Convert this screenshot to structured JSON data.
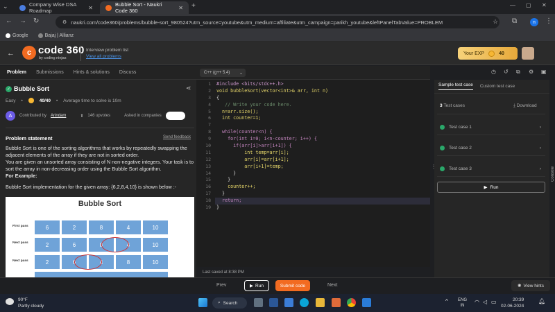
{
  "browser": {
    "tabs": [
      {
        "title": "Company Wise DSA Roadmap",
        "active": false
      },
      {
        "title": "Bubble Sort - Naukri Code 360",
        "active": true
      }
    ],
    "url": "naukri.com/code360/problems/bubble-sort_980524?utm_source=youtube&utm_medium=affiliate&utm_campaign=parikh_youtube&leftPanelTabValue=PROBLEM",
    "bookmarks": [
      "Google",
      "Bajaj | Allianz"
    ],
    "profile_initial": "n"
  },
  "header": {
    "logo_letter": "c",
    "logo_text": "code 360",
    "logo_sub": "by coding ninjas",
    "interview_label": "Interview problem list",
    "interview_link": "View all problems",
    "exp_label": "Your EXP",
    "exp_value": "40"
  },
  "left": {
    "tabs": [
      "Problem",
      "Submissions",
      "Hints & solutions",
      "Discuss"
    ],
    "title": "Bubble Sort",
    "difficulty": "Easy",
    "score": "40/40",
    "avg_time": "Average time to solve is 10m",
    "contributed_prefix": "Contributed by",
    "contributor": "Arindam",
    "upvotes": "146 upvotes",
    "asked_in": "Asked in companies",
    "statement_head": "Problem statement",
    "send_feedback": "Send feedback",
    "desc1": "Bubble Sort is one of the sorting algorithms that works by repeatedly swapping the adjacent elements of the array if they are not in sorted order.",
    "desc2": "You are given an unsorted array consisting of N non-negative integers. Your task is to sort the array in non-decreasing order using the Bubble Sort algorithm.",
    "for_example": "For Example:",
    "example_line": "Bubble Sort implementation for the given array:  {6,2,8,4,10} is shown below :-",
    "image": {
      "title": "Bubble Sort",
      "rows": [
        {
          "label": "First pass",
          "cells": [
            "6",
            "2",
            "8",
            "4",
            "10"
          ]
        },
        {
          "label": "Next pass",
          "cells": [
            "2",
            "6",
            "8",
            "4",
            "10"
          ]
        },
        {
          "label": "Next pass",
          "cells": [
            "2",
            "6",
            "4",
            "8",
            "10"
          ]
        }
      ]
    }
  },
  "editor": {
    "language": "C++ (g++ 5.4)",
    "line_numbers": [
      "1",
      "2",
      "3",
      "4",
      "5",
      "6",
      "7",
      "8",
      "9",
      "10",
      "11",
      "12",
      "13",
      "14",
      "15",
      "16",
      "17",
      "18",
      "19"
    ],
    "code": [
      "#include <bits/stdc++.h>",
      "void bubbleSort(vector<int>& arr, int n)",
      "{",
      "   // Write your code here.",
      "  n=arr.size();",
      "  int counter=1;",
      "",
      "  while(counter<n) {",
      "    for(int i=0; i<n-counter; i++) {",
      "      if(arr[i]>arr[i+1]) {",
      "          int temp=arr[i];",
      "          arr[i]=arr[i+1];",
      "          arr[i+1]=temp;",
      "      }",
      "    }",
      "    counter++;",
      "  }",
      "  return;",
      "}"
    ],
    "last_saved": "Last saved at 8:38 PM"
  },
  "right": {
    "tabs": [
      "Sample test case",
      "Custom test case"
    ],
    "count_num": "3",
    "count_label": "Test cases",
    "download": "Download",
    "cases": [
      "Test case 1",
      "Test case 2",
      "Test case 3"
    ],
    "run": "Run",
    "console": "Console"
  },
  "bottom": {
    "prev": "Prev",
    "run": "Run",
    "submit": "Submit code",
    "next": "Next",
    "hints": "View hints"
  },
  "taskbar": {
    "temp": "90°F",
    "weather": "Partly cloudy",
    "search": "Search",
    "lang": "ENG",
    "region": "IN",
    "time": "20:39",
    "date": "02-06-2024"
  },
  "colors": {
    "accent": "#f26b21",
    "success": "#2aa86a",
    "link": "#4a90e2"
  }
}
